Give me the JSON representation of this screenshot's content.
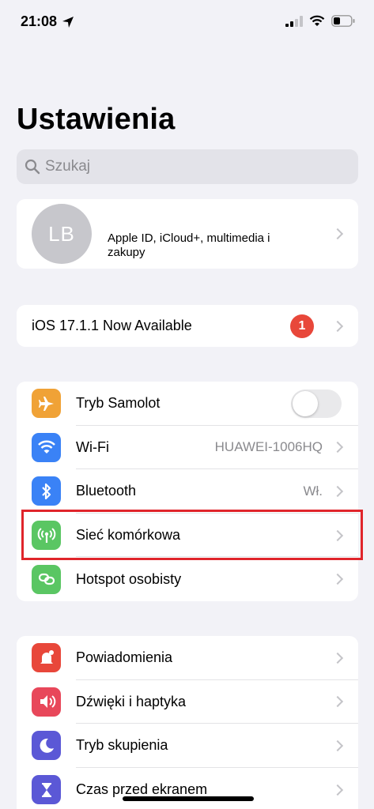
{
  "status": {
    "time": "21:08",
    "icons": [
      "location-arrow-icon",
      "cellular-signal-icon",
      "wifi-icon",
      "battery-icon"
    ]
  },
  "title": "Ustawienia",
  "search": {
    "placeholder": "Szukaj"
  },
  "profile": {
    "initials": "LB",
    "subtitle": "Apple ID, iCloud+, multimedia i zakupy"
  },
  "update": {
    "label": "iOS 17.1.1 Now Available",
    "badge": "1"
  },
  "connectivity": [
    {
      "label": "Tryb Samolot",
      "value": "",
      "icon": "airplane-icon",
      "color": "#f0a236",
      "toggle": false
    },
    {
      "label": "Wi-Fi",
      "value": "HUAWEI-1006HQ",
      "icon": "wifi-icon",
      "color": "#3a82f6"
    },
    {
      "label": "Bluetooth",
      "value": "Wł.",
      "icon": "bluetooth-icon",
      "color": "#3a82f6"
    },
    {
      "label": "Sieć komórkowa",
      "value": "",
      "icon": "antenna-icon",
      "color": "#5ac663"
    },
    {
      "label": "Hotspot osobisty",
      "value": "",
      "icon": "hotspot-icon",
      "color": "#5ac663"
    }
  ],
  "notifications": [
    {
      "label": "Powiadomienia",
      "icon": "bell-icon",
      "color": "#e8473a"
    },
    {
      "label": "Dźwięki i haptyka",
      "icon": "speaker-icon",
      "color": "#e8475a"
    },
    {
      "label": "Tryb skupienia",
      "icon": "moon-icon",
      "color": "#5b58d6"
    },
    {
      "label": "Czas przed ekranem",
      "icon": "hourglass-icon",
      "color": "#5b58d6"
    }
  ],
  "colors": {
    "background": "#f2f2f7",
    "highlight": "#e0252b",
    "badge": "#e8473a"
  }
}
